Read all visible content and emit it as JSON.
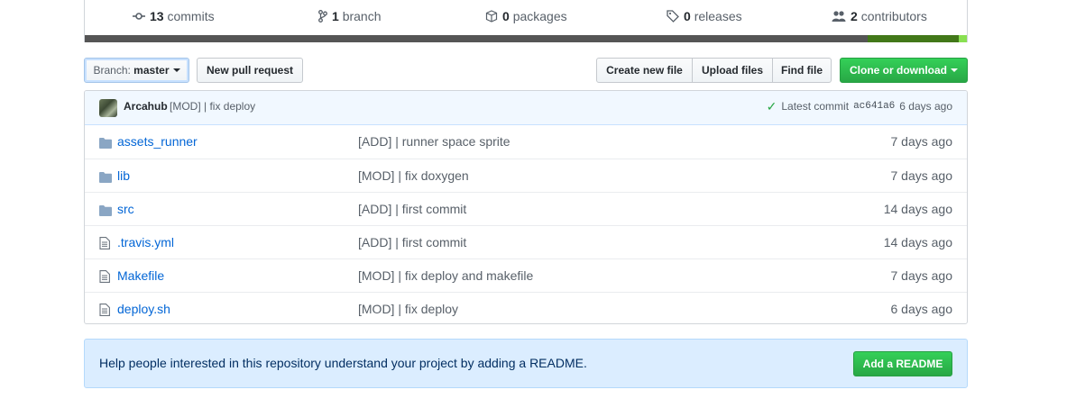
{
  "summary": {
    "commits": {
      "count": "13",
      "label": "commits"
    },
    "branches": {
      "count": "1",
      "label": "branch"
    },
    "packages": {
      "count": "0",
      "label": "packages"
    },
    "releases": {
      "count": "0",
      "label": "releases"
    },
    "contributors": {
      "count": "2",
      "label": "contributors"
    },
    "language_colors": [
      "#555555",
      "#427819",
      "#89e051"
    ],
    "language_fractions": [
      0.888,
      0.103,
      0.009
    ]
  },
  "toolbar": {
    "branch_prefix": "Branch:",
    "branch_name": "master",
    "new_pr": "New pull request",
    "create_file": "Create new file",
    "upload_files": "Upload files",
    "find_file": "Find file",
    "clone_download": "Clone or download"
  },
  "commit": {
    "author": "Arcahub",
    "message": "[MOD] | fix deploy",
    "latest_label": "Latest commit",
    "sha": "ac641a6",
    "age": "6 days ago"
  },
  "files": [
    {
      "type": "folder",
      "name": "assets_runner",
      "message": "[ADD] | runner space sprite",
      "age": "7 days ago"
    },
    {
      "type": "folder",
      "name": "lib",
      "message": "[MOD] | fix doxygen",
      "age": "7 days ago"
    },
    {
      "type": "folder",
      "name": "src",
      "message": "[ADD] | first commit",
      "age": "14 days ago"
    },
    {
      "type": "file",
      "name": ".travis.yml",
      "message": "[ADD] | first commit",
      "age": "14 days ago"
    },
    {
      "type": "file",
      "name": "Makefile",
      "message": "[MOD] | fix deploy and makefile",
      "age": "7 days ago"
    },
    {
      "type": "file",
      "name": "deploy.sh",
      "message": "[MOD] | fix deploy",
      "age": "6 days ago"
    }
  ],
  "readme": {
    "prompt": "Help people interested in this repository understand your project by adding a README.",
    "button": "Add a README"
  }
}
